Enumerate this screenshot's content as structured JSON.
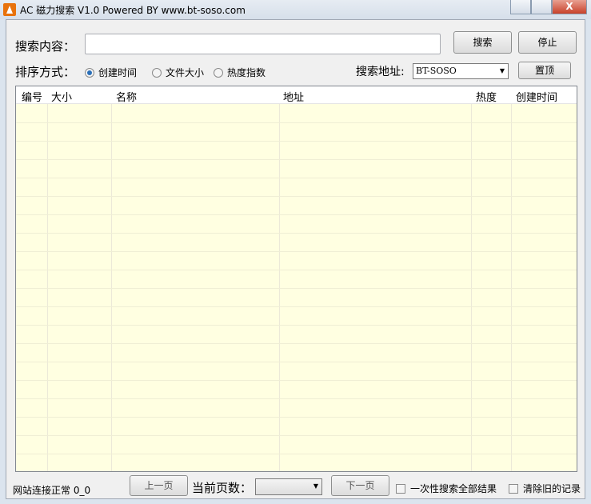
{
  "window": {
    "title": "AC 磁力搜索 V1.0 Powered BY www.bt-soso.com",
    "close": "X"
  },
  "search": {
    "label": "搜索内容：",
    "value": "",
    "search_btn": "搜索",
    "stop_btn": "停止"
  },
  "sort": {
    "label": "排序方式：",
    "options": [
      {
        "label": "创建时间",
        "selected": true
      },
      {
        "label": "文件大小",
        "selected": false
      },
      {
        "label": "热度指数",
        "selected": false
      }
    ]
  },
  "source": {
    "label": "搜索地址:",
    "value": "BT-SOSO",
    "top_btn": "置顶"
  },
  "table": {
    "columns": [
      "编号",
      "大小",
      "名称",
      "地址",
      "热度",
      "创建时间"
    ],
    "rows": []
  },
  "footer": {
    "status": "网站连接正常 0_0",
    "prev": "上一页",
    "page_label": "当前页数：",
    "page_value": "",
    "next": "下一页",
    "opt_all": "一次性搜索全部结果",
    "opt_clear": "清除旧的记录"
  }
}
